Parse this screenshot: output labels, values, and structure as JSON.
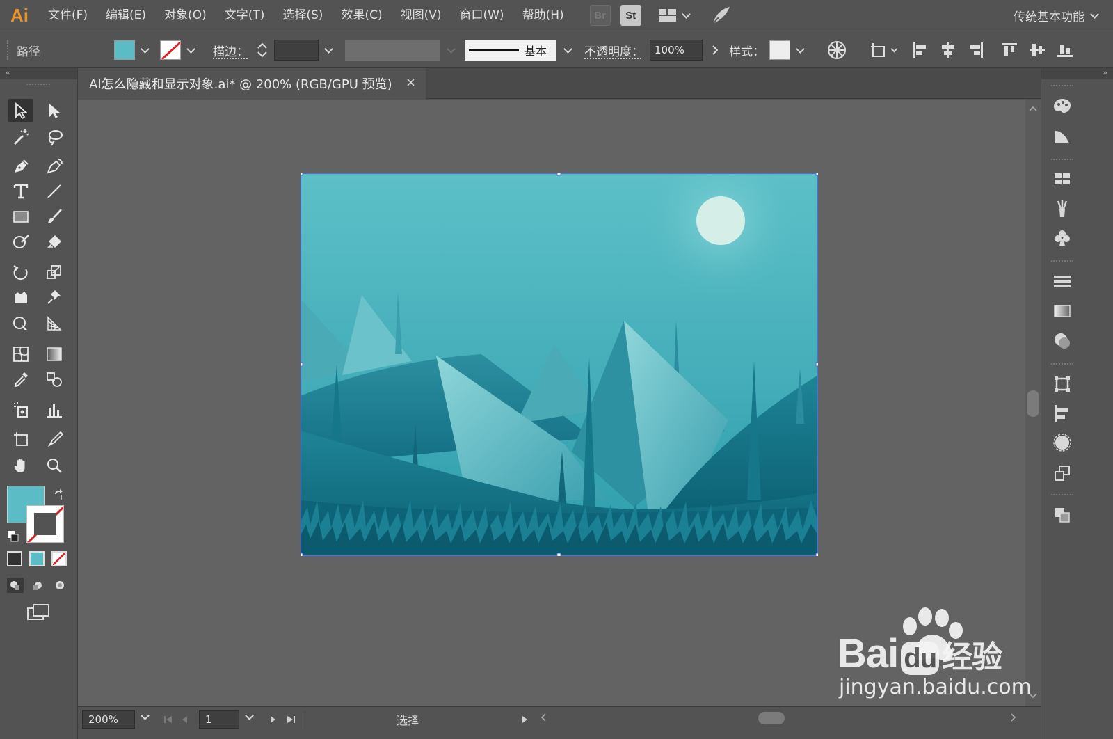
{
  "app": {
    "logo": "Ai",
    "workspace": "传统基本功能"
  },
  "menu": [
    "文件(F)",
    "编辑(E)",
    "对象(O)",
    "文字(T)",
    "选择(S)",
    "效果(C)",
    "视图(V)",
    "窗口(W)",
    "帮助(H)"
  ],
  "menubar_icons": {
    "bridge": "Br",
    "stock": "St"
  },
  "control": {
    "object_type": "路径",
    "fill_color": "#5bbcc6",
    "stroke_label": "描边：",
    "stroke_profile": "基本",
    "opacity_label": "不透明度：",
    "opacity_value": "100%",
    "style_label": "样式："
  },
  "document": {
    "tab_title": "AI怎么隐藏和显示对象.ai* @ 200% (RGB/GPU 预览)",
    "close": "×"
  },
  "tools": {
    "fill_color": "#5bbcc6",
    "items": [
      "selection-tool",
      "direct-selection-tool",
      "magic-wand-tool",
      "lasso-tool",
      "pen-tool",
      "curvature-tool",
      "type-tool",
      "line-tool",
      "rectangle-tool",
      "paintbrush-tool",
      "shaper-tool",
      "eraser-tool",
      "rotate-tool",
      "scale-tool",
      "warp-tool",
      "puppet-warp-tool",
      "shape-builder-tool",
      "perspective-grid-tool",
      "mesh-tool",
      "gradient-tool",
      "eyedropper-tool",
      "blend-tool",
      "symbol-sprayer-tool",
      "column-graph-tool",
      "artboard-tool",
      "slice-tool",
      "hand-tool",
      "zoom-tool"
    ]
  },
  "status": {
    "zoom": "200%",
    "page": "1",
    "mode": "选择"
  },
  "watermark": {
    "brand": "Bai",
    "brand2": "du",
    "brand_cn": "经验",
    "url": "jingyan.baidu.com"
  },
  "colors": {
    "accent": "#e8922a",
    "sky_top": "#5dc0c8",
    "sky_bottom": "#2a9aa8",
    "moon": "#d5eee8",
    "ground": "#0b5f72"
  }
}
